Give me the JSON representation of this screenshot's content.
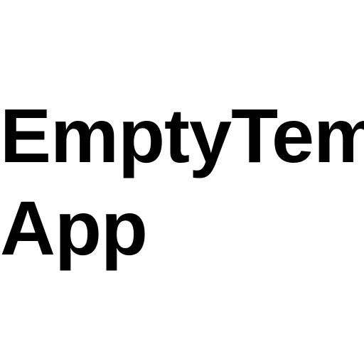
{
  "app": {
    "name_line1": "EmptyTemi",
    "name_line2": "App"
  },
  "colors": {
    "background": "#ffffff",
    "text": "#000000"
  }
}
